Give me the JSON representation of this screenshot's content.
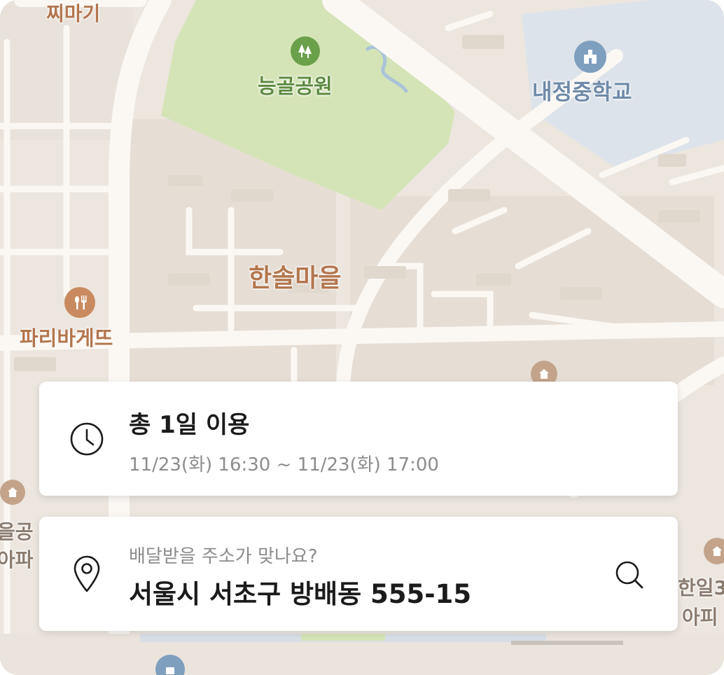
{
  "map": {
    "labels": {
      "top_left_partial": "찌마기",
      "park": "능골공원",
      "school": "내정중학교",
      "village": "한솔마을",
      "bakery": "파리바게뜨",
      "left_partial_1": "을공",
      "left_partial_2": "아파",
      "right_partial_1": "한일3",
      "right_partial_2": "아피"
    },
    "icons": {
      "park": "tree-icon",
      "school": "school-icon",
      "bakery": "fork-knife-icon",
      "building": "building-icon"
    },
    "colors": {
      "background": "#ece6df",
      "road": "#fbf8f4",
      "park": "#d5e4b7",
      "school_zone": "#dde3ea",
      "village_label": "#b3764e",
      "park_label": "#5d8a40",
      "school_label": "#6f8aa8",
      "bakery_label": "#b3764e"
    }
  },
  "usage_card": {
    "icon": "clock-icon",
    "title": "총 1일 이용",
    "period": "11/23(화) 16:30 ~ 11/23(화) 17:00"
  },
  "address_card": {
    "icon": "location-pin-icon",
    "question": "배달받을 주소가 맞나요?",
    "address": "서울시 서초구 방배동 555-15",
    "search_icon": "search-icon"
  }
}
